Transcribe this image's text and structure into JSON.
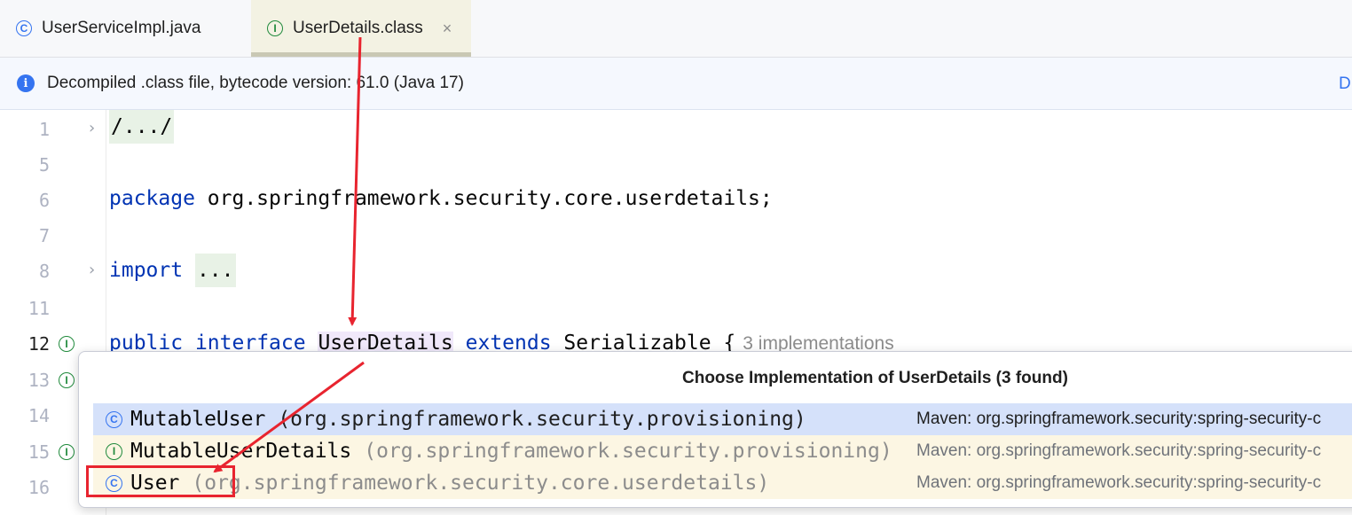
{
  "tabs": [
    {
      "label": "UserServiceImpl.java",
      "icon": "C",
      "active": false
    },
    {
      "label": "UserDetails.class",
      "icon": "I",
      "active": true,
      "close": "×"
    }
  ],
  "banner": {
    "text": "Decompiled .class file, bytecode version: 61.0 (Java 17)",
    "link": "D"
  },
  "editor": {
    "line_numbers": [
      "1",
      "5",
      "6",
      "7",
      "8",
      "11",
      "12",
      "13",
      "14",
      "15",
      "16"
    ],
    "line1": "/.../",
    "package_kw": "package",
    "package_name": " org.springframework.security.core.userdetails;",
    "import_kw": "import",
    "import_folded": "...",
    "decl_public": "public",
    "decl_interface": "interface",
    "decl_name": "UserDetails",
    "decl_extends": "extends",
    "decl_super": " Serializable {",
    "impl_hint": "3 implementations"
  },
  "popup": {
    "title": "Choose Implementation of UserDetails (3 found)",
    "items": [
      {
        "icon": "C",
        "name": "MutableUser",
        "package": "(org.springframework.security.provisioning)",
        "source": "Maven: org.springframework.security:spring-security-c"
      },
      {
        "icon": "I",
        "name": "MutableUserDetails",
        "package": "(org.springframework.security.provisioning)",
        "source": "Maven: org.springframework.security:spring-security-c"
      },
      {
        "icon": "C",
        "name": "User",
        "package": "(org.springframework.security.core.userdetails)",
        "source": "Maven: org.springframework.security:spring-security-c"
      }
    ]
  },
  "colors": {
    "accent": "#3574f0",
    "keyword": "#0033b3",
    "interface_icon": "#208a3c",
    "annotation_red": "#e8242f",
    "selected_row": "#d5e1fa"
  }
}
